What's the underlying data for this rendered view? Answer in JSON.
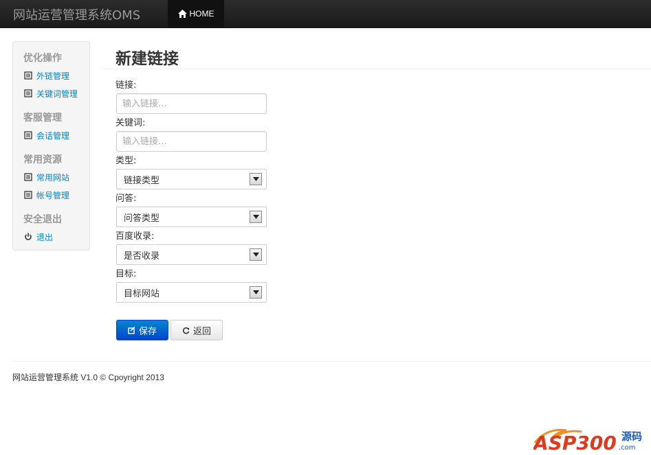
{
  "app": {
    "brand": "网站运营管理系统OMS",
    "nav_home": "HOME"
  },
  "sidebar": {
    "groups": [
      {
        "header": "优化操作",
        "items": [
          {
            "label": "外链管理",
            "icon": "list-icon"
          },
          {
            "label": "关键词管理",
            "icon": "list-icon"
          }
        ]
      },
      {
        "header": "客服管理",
        "items": [
          {
            "label": "会话管理",
            "icon": "list-icon"
          }
        ]
      },
      {
        "header": "常用资源",
        "items": [
          {
            "label": "常用网站",
            "icon": "list-icon"
          },
          {
            "label": "帐号管理",
            "icon": "list-icon"
          }
        ]
      },
      {
        "header": "安全退出",
        "items": [
          {
            "label": "退出",
            "icon": "power-icon"
          }
        ]
      }
    ]
  },
  "form": {
    "title": "新建链接",
    "link_label": "链接:",
    "link_placeholder": "输入链接…",
    "keyword_label": "关键词:",
    "keyword_placeholder": "输入链接…",
    "type_label": "类型:",
    "type_value": "链接类型",
    "qa_label": "问答:",
    "qa_value": "问答类型",
    "baidu_label": "百度收录:",
    "baidu_value": "是否收录",
    "target_label": "目标:",
    "target_value": "目标网站",
    "save_label": "保存",
    "back_label": "返回"
  },
  "footer": {
    "text": "网站运营管理系统 V1.0 © Cpoyright 2013"
  },
  "watermark": {
    "text": "ASP300",
    "suffix": "源码",
    "domain": ".com"
  },
  "colors": {
    "link": "#0088cc",
    "primary": "#0055cc",
    "navbar": "#1b1b1b"
  }
}
